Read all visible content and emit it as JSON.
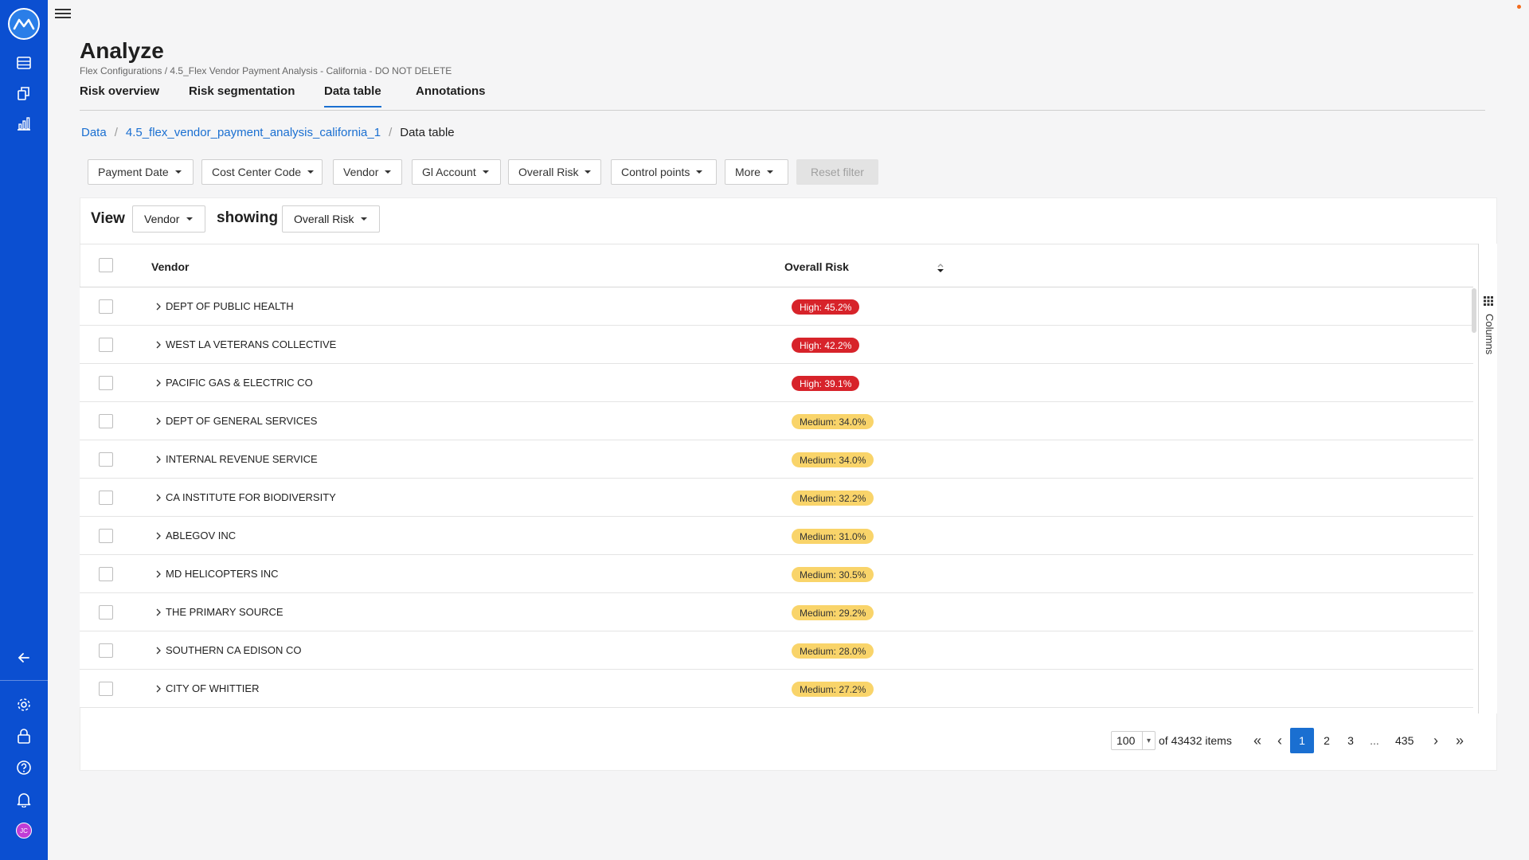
{
  "header": {
    "title": "Analyze",
    "breadcrumb": "Flex Configurations / 4.5_Flex Vendor Payment Analysis - California - DO NOT DELETE"
  },
  "tabs": [
    {
      "label": "Risk overview"
    },
    {
      "label": "Risk segmentation"
    },
    {
      "label": "Data table"
    },
    {
      "label": "Annotations"
    }
  ],
  "data_breadcrumb": {
    "root": "Data",
    "dataset": "4.5_flex_vendor_payment_analysis_california_1",
    "current": "Data table"
  },
  "filters": [
    {
      "label": "Payment Date"
    },
    {
      "label": "Cost Center Code"
    },
    {
      "label": "Vendor"
    },
    {
      "label": "Gl Account"
    },
    {
      "label": "Overall Risk"
    },
    {
      "label": "Control points"
    },
    {
      "label": "More"
    }
  ],
  "reset_filter": "Reset filter",
  "view": {
    "view_label": "View",
    "view_value": "Vendor",
    "showing_label": "showing",
    "showing_value": "Overall Risk"
  },
  "table": {
    "columns": [
      "Vendor",
      "Overall Risk"
    ],
    "rows": [
      {
        "vendor": "DEPT OF PUBLIC HEALTH",
        "risk": "High: 45.2%",
        "level": "high"
      },
      {
        "vendor": "WEST LA VETERANS COLLECTIVE",
        "risk": "High: 42.2%",
        "level": "high"
      },
      {
        "vendor": "PACIFIC GAS & ELECTRIC CO",
        "risk": "High: 39.1%",
        "level": "high"
      },
      {
        "vendor": "DEPT OF GENERAL SERVICES",
        "risk": "Medium: 34.0%",
        "level": "medium"
      },
      {
        "vendor": "INTERNAL REVENUE SERVICE",
        "risk": "Medium: 34.0%",
        "level": "medium"
      },
      {
        "vendor": "CA INSTITUTE FOR BIODIVERSITY",
        "risk": "Medium: 32.2%",
        "level": "medium"
      },
      {
        "vendor": "ABLEGOV INC",
        "risk": "Medium: 31.0%",
        "level": "medium"
      },
      {
        "vendor": "MD HELICOPTERS INC",
        "risk": "Medium: 30.5%",
        "level": "medium"
      },
      {
        "vendor": "THE PRIMARY SOURCE",
        "risk": "Medium: 29.2%",
        "level": "medium"
      },
      {
        "vendor": "SOUTHERN CA EDISON CO",
        "risk": "Medium: 28.0%",
        "level": "medium"
      },
      {
        "vendor": "CITY OF WHITTIER",
        "risk": "Medium: 27.2%",
        "level": "medium"
      }
    ],
    "columns_panel_label": "Columns"
  },
  "pagination": {
    "page_size": "100",
    "items_text": "of 43432 items",
    "pages": [
      "1",
      "2",
      "3",
      "...",
      "435"
    ],
    "active_page": "1"
  },
  "user": {
    "initials": "JC"
  },
  "colors": {
    "sidebar": "#0b4fd1",
    "accent": "#1a6fd1",
    "risk_high": "#d7232a",
    "risk_medium": "#f9d46a"
  }
}
